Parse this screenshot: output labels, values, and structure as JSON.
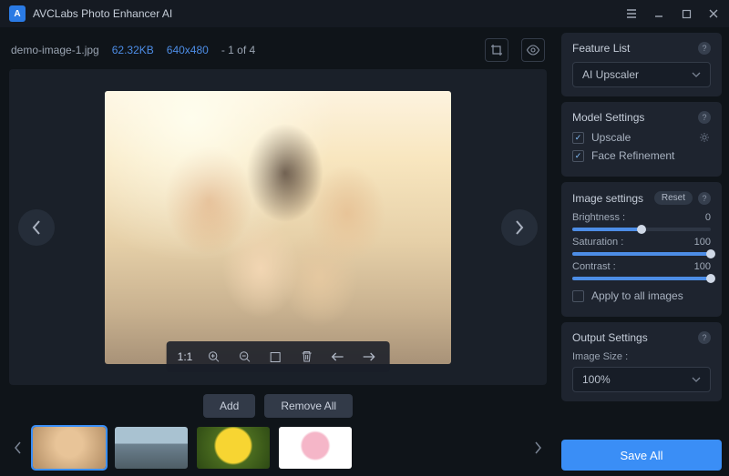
{
  "app": {
    "title": "AVCLabs Photo Enhancer AI"
  },
  "file": {
    "name": "demo-image-1.jpg",
    "size": "62.32KB",
    "dimensions": "640x480",
    "count": "- 1 of 4"
  },
  "toolbar": {
    "ratio": "1:1"
  },
  "buttons": {
    "add": "Add",
    "removeAll": "Remove All"
  },
  "feature": {
    "title": "Feature List",
    "selected": "AI Upscaler"
  },
  "model": {
    "title": "Model Settings",
    "upscale": "Upscale",
    "face": "Face Refinement"
  },
  "image": {
    "title": "Image settings",
    "reset": "Reset",
    "brightness": {
      "label": "Brightness :",
      "value": 0,
      "pct": 50
    },
    "saturation": {
      "label": "Saturation :",
      "value": 100,
      "pct": 100
    },
    "contrast": {
      "label": "Contrast :",
      "value": 100,
      "pct": 100
    },
    "applyAll": "Apply to all images"
  },
  "output": {
    "title": "Output Settings",
    "sizeLabel": "Image Size :",
    "size": "100%"
  },
  "save": "Save All"
}
